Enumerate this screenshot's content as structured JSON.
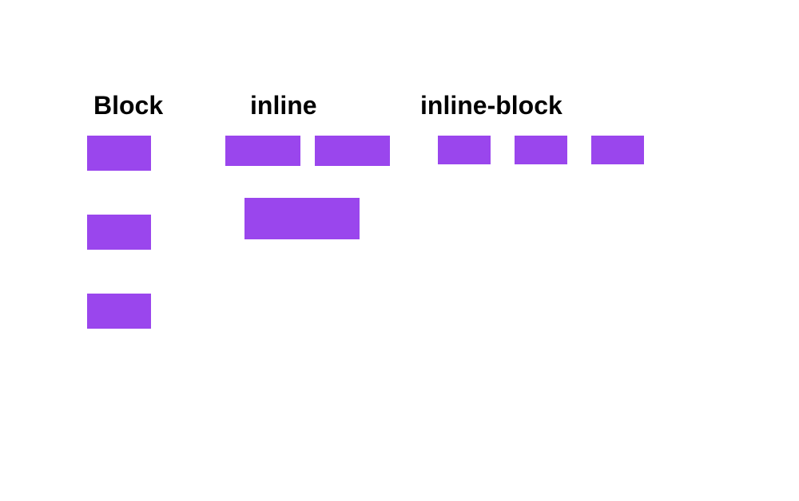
{
  "headings": {
    "block": "Block",
    "inline": "inline",
    "inlineBlock": "inline-block"
  },
  "colors": {
    "box": "#9a46ed",
    "text": "#000000",
    "background": "#ffffff"
  },
  "layout": {
    "description": "Diagram illustrating CSS display property behaviors: block elements stack vertically, inline elements flow horizontally and wrap, inline-block elements flow horizontally on one line",
    "sections": [
      {
        "name": "Block",
        "boxes": 3,
        "arrangement": "vertical-stack"
      },
      {
        "name": "inline",
        "boxes": 3,
        "arrangement": "horizontal-then-wrap"
      },
      {
        "name": "inline-block",
        "boxes": 3,
        "arrangement": "horizontal-row"
      }
    ]
  }
}
